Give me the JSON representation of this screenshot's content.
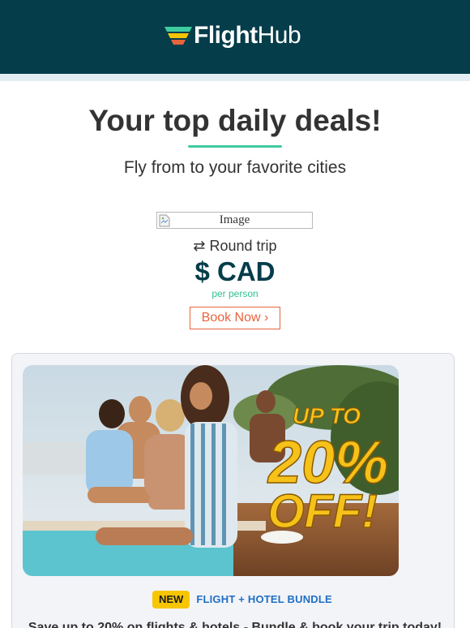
{
  "header": {
    "logo_bold": "Flight",
    "logo_light": "Hub",
    "logo_icon": "flighthub-wing-logo",
    "colors": {
      "background": "#053d4a",
      "stripe_1": "#3ecba0",
      "stripe_2": "#f5c400",
      "stripe_3": "#e8643c"
    }
  },
  "hero": {
    "title": "Your top daily deals!",
    "subtitle": "Fly from to your favorite cities",
    "rule_color": "#3ecba0"
  },
  "deal": {
    "image_alt": "Image",
    "trip_icon": "round-trip-arrows-icon",
    "trip_glyph": "⇄",
    "trip_type": "Round trip",
    "price": "$ CAD",
    "per_person": "per person",
    "book_label": "Book Now ›",
    "accent": "#e8643c"
  },
  "promo": {
    "image_text_line1": "UP TO",
    "image_text_line2": "20%",
    "image_text_line3": "OFF!",
    "badge": "NEW",
    "bundle_label": "FLIGHT + HOTEL BUNDLE",
    "copy": "Save up to 20% on flights & hotels - Bundle & book your trip today!",
    "badge_color": "#f7c600",
    "label_color": "#1f6fc4"
  }
}
